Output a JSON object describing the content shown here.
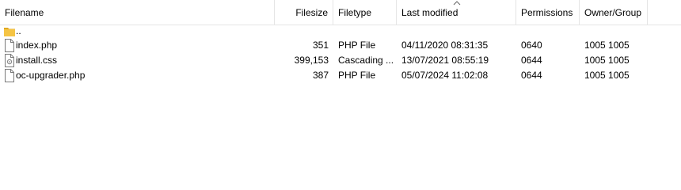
{
  "columns": {
    "filename": "Filename",
    "filesize": "Filesize",
    "filetype": "Filetype",
    "last_modified": "Last modified",
    "permissions": "Permissions",
    "owner_group": "Owner/Group"
  },
  "sort": {
    "column": "last_modified",
    "indicator": "up-arrow-icon"
  },
  "parent": {
    "name": "..",
    "icon": "folder-icon"
  },
  "files": [
    {
      "name": "index.php",
      "icon": "file-icon",
      "size": "351",
      "type": "PHP File",
      "modified": "04/11/2020 08:31:35",
      "permissions": "0640",
      "owner": "1005 1005"
    },
    {
      "name": "install.css",
      "icon": "css-file-icon",
      "size": "399,153",
      "type": "Cascading ...",
      "modified": "13/07/2021 08:55:19",
      "permissions": "0644",
      "owner": "1005 1005"
    },
    {
      "name": "oc-upgrader.php",
      "icon": "file-icon",
      "size": "387",
      "type": "PHP File",
      "modified": "05/07/2024 11:02:08",
      "permissions": "0644",
      "owner": "1005 1005"
    }
  ],
  "colors": {
    "folder": "#f5c444",
    "folder_dark": "#e0a820",
    "divider": "#e5e5e5"
  }
}
